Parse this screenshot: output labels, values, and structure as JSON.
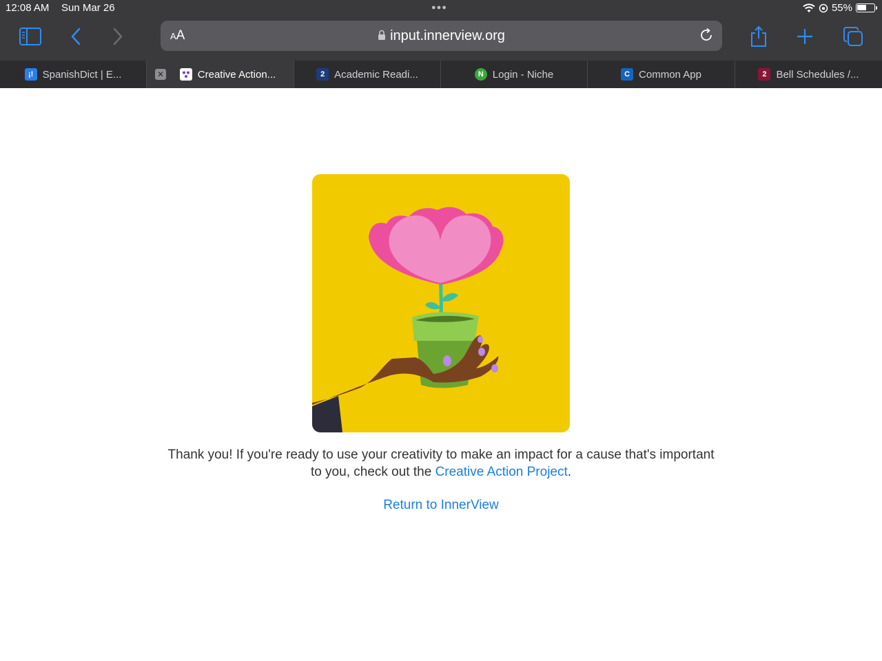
{
  "status": {
    "time": "12:08 AM",
    "date": "Sun Mar 26",
    "battery_text": "55%",
    "battery_level": 0.55
  },
  "toolbar": {
    "text_size_label": "AA",
    "url": "input.innerview.org"
  },
  "tabs": [
    {
      "title": "SpanishDict | E...",
      "favicon_color": "#2b7de9",
      "favicon_text": "¡!",
      "active": false
    },
    {
      "title": "Creative Action...",
      "favicon_color": "#ffffff",
      "favicon_text": "",
      "active": true
    },
    {
      "title": "Academic Readi...",
      "favicon_color": "#1f3b7a",
      "favicon_text": "2",
      "active": false
    },
    {
      "title": "Login - Niche",
      "favicon_color": "#38a83c",
      "favicon_text": "N",
      "active": false
    },
    {
      "title": "Common App",
      "favicon_color": "#1565c0",
      "favicon_text": "C",
      "active": false
    },
    {
      "title": "Bell Schedules /...",
      "favicon_color": "#8b1538",
      "favicon_text": "2",
      "active": false
    }
  ],
  "page": {
    "message_part1": "Thank you! If you're ready to use your creativity to make an impact for a cause that's important to you, check out the",
    "message_link": "Creative Action Project",
    "message_end": ".",
    "return_link": "Return to InnerView"
  },
  "colors": {
    "chrome": "#3a3a3c",
    "link": "#1a7fe0",
    "illustration_bg": "#f2ca00"
  }
}
